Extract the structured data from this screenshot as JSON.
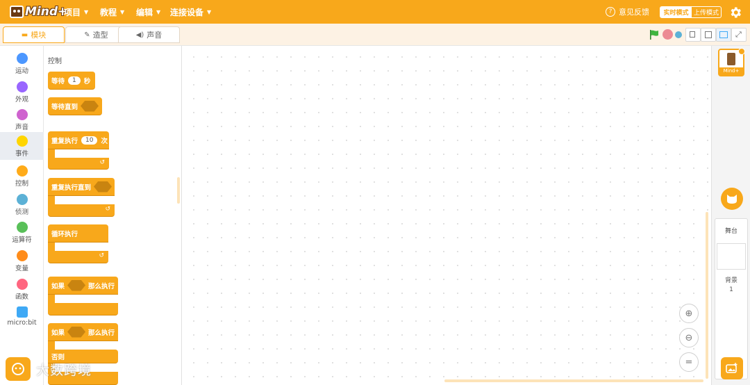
{
  "topbar": {
    "logo_text": "Mind+",
    "menus": [
      "项目",
      "教程",
      "编辑",
      "连接设备"
    ],
    "feedback": "意见反馈",
    "mode_realtime": "实时模式",
    "mode_upload": "上传模式"
  },
  "tabs": [
    {
      "label": "模块",
      "icon": "blocks-icon"
    },
    {
      "label": "造型",
      "icon": "brush-icon"
    },
    {
      "label": "声音",
      "icon": "speaker-icon"
    }
  ],
  "categories": [
    {
      "label": "运动",
      "color": "#4c97ff"
    },
    {
      "label": "外观",
      "color": "#9966ff"
    },
    {
      "label": "声音",
      "color": "#cf63cf"
    },
    {
      "label": "事件",
      "color": "#ffd500"
    },
    {
      "label": "控制",
      "color": "#ffab19"
    },
    {
      "label": "侦测",
      "color": "#5cb1d6"
    },
    {
      "label": "运算符",
      "color": "#59c059"
    },
    {
      "label": "变量",
      "color": "#ff8c1a"
    },
    {
      "label": "函数",
      "color": "#ff6680"
    },
    {
      "label": "micro:bit",
      "color": "#3fa9f5"
    }
  ],
  "palette": {
    "title": "控制",
    "wait": {
      "label": "等待",
      "value": "1",
      "unit": "秒"
    },
    "wait_until": {
      "label": "等待直到"
    },
    "repeat": {
      "label": "重复执行",
      "value": "10",
      "unit": "次"
    },
    "repeat_until": {
      "label": "重复执行直到"
    },
    "forever": {
      "label": "循环执行"
    },
    "if_then": {
      "label": "如果",
      "then": "那么执行"
    },
    "if_else": {
      "label": "如果",
      "then": "那么执行",
      "else": "否则"
    }
  },
  "sprite": {
    "name": "Mind+"
  },
  "stage": {
    "label": "舞台",
    "backdrop_label": "背景",
    "backdrop_count": "1"
  },
  "watermark": "大数跨境",
  "colors": {
    "accent": "#f8a81b",
    "control_block": "#f8a81b"
  }
}
